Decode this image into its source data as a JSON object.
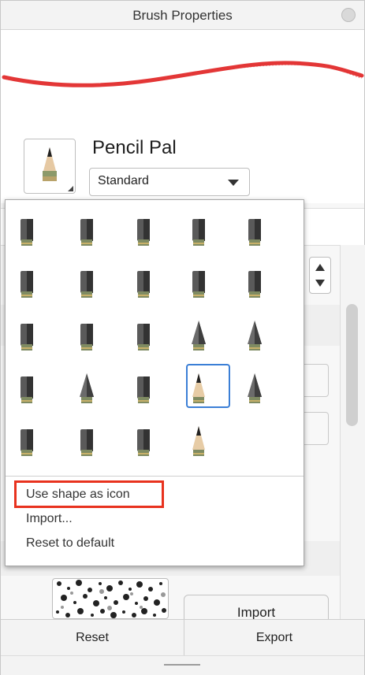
{
  "window": {
    "title": "Brush Properties"
  },
  "preview": {
    "stroke_color": "#e02020"
  },
  "brush": {
    "name": "Pencil Pal",
    "type_selected": "Standard"
  },
  "popup": {
    "tips": [
      {
        "name": "felt-marker-tip-icon"
      },
      {
        "name": "cartridge-pen-tip-icon"
      },
      {
        "name": "nib-pen-tip-icon"
      },
      {
        "name": "chisel-tip-icon"
      },
      {
        "name": "chisel-thin-tip-icon"
      },
      {
        "name": "rough-round-tip-icon"
      },
      {
        "name": "rough-flat-tip-icon"
      },
      {
        "name": "rough-tall-tip-icon"
      },
      {
        "name": "slanted-tip-icon"
      },
      {
        "name": "small-rough-tip-icon"
      },
      {
        "name": "short-round-tip-icon"
      },
      {
        "name": "angled-block-tip-icon"
      },
      {
        "name": "rough-wide-tip-icon"
      },
      {
        "name": "cone-tip-icon"
      },
      {
        "name": "marker-cone-tip-icon"
      },
      {
        "name": "bristle-brush-tip-icon"
      },
      {
        "name": "ink-pen-tip-icon"
      },
      {
        "name": "round-block-tip-icon"
      },
      {
        "name": "pencil-tip-icon"
      },
      {
        "name": "stepped-cone-tip-icon"
      },
      {
        "name": "banded-block-tip-icon"
      },
      {
        "name": "wide-banded-tip-icon"
      },
      {
        "name": "small-banded-tip-icon"
      },
      {
        "name": "paint-brush-tip-icon"
      }
    ],
    "selected_index": 18,
    "menu": {
      "use_shape_label": "Use shape as icon",
      "import_label": "Import...",
      "reset_label": "Reset to default"
    }
  },
  "panel": {
    "import_label": "Import"
  },
  "footer": {
    "reset_label": "Reset",
    "export_label": "Export"
  },
  "colors": {
    "accent": "#3b7fd6",
    "highlight": "#e8321e",
    "stroke": "#e02020"
  }
}
